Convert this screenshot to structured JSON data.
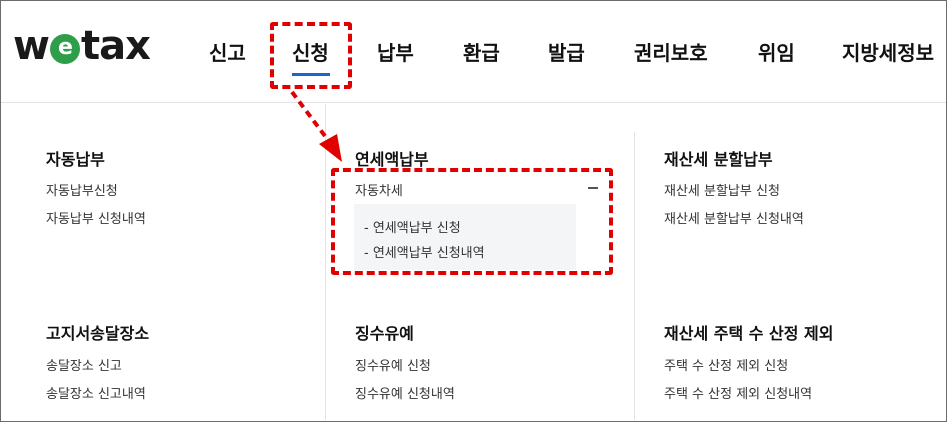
{
  "header": {
    "logo": {
      "prefix": "w",
      "e_letter": "e",
      "suffix": "tax"
    },
    "nav": [
      "신고",
      "신청",
      "납부",
      "환급",
      "발급",
      "권리보호",
      "위임",
      "지방세정보"
    ],
    "active_nav": "신청"
  },
  "menu": {
    "auto_pay": {
      "title": "자동납부",
      "links": [
        "자동납부신청",
        "자동납부 신청내역"
      ]
    },
    "annual_pay": {
      "title": "연세액납부",
      "group": "자동차세",
      "sub_links": [
        "- 연세액납부 신청",
        "- 연세액납부 신청내역"
      ]
    },
    "property_split": {
      "title": "재산세 분할납부",
      "links": [
        "재산세 분할납부 신청",
        "재산세 분할납부 신청내역"
      ]
    },
    "notice_place": {
      "title": "고지서송달장소",
      "links": [
        "송달장소 신고",
        "송달장소 신고내역"
      ]
    },
    "deferral": {
      "title": "징수유예",
      "links": [
        "징수유예 신청",
        "징수유예 신청내역"
      ]
    },
    "house_exclusion": {
      "title": "재산세 주택 수 산정 제외",
      "links": [
        "주택 수 산정 제외 신청",
        "주택 수 산정 제외 신청내역"
      ]
    }
  },
  "colors": {
    "accent": "#1e66c6",
    "annotation": "#e00000",
    "logo_green": "#2f9e4a"
  }
}
